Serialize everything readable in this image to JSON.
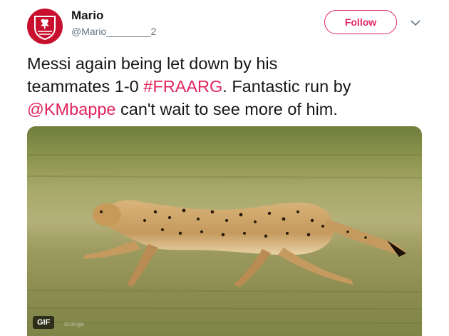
{
  "user": {
    "name": "Mario",
    "handle": "@Mario________2",
    "avatar_icon": "liverpool-crest-icon"
  },
  "follow": {
    "label": "Follow"
  },
  "menu": {
    "icon": "chevron-down-icon"
  },
  "tweet": {
    "line1": "Messi again being let down by his",
    "line2_pre": "teammates 1-0 ",
    "hashtag": "#FRAARG",
    "line2_post": ". Fantastic run by",
    "mention": "@KMbappe",
    "line3_post": " can't wait to see more of him."
  },
  "media": {
    "badge": "GIF",
    "subject_icon": "cheetah-running-icon",
    "watermark": "orange"
  },
  "colors": {
    "accent": "#e0245e",
    "text": "#14171a",
    "muted": "#657786",
    "avatar_bg": "#c8102e"
  }
}
